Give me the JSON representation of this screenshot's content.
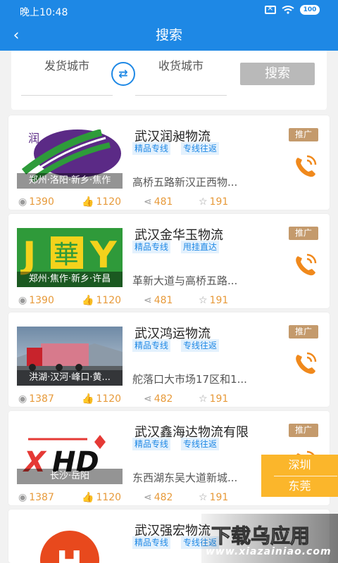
{
  "status": {
    "time": "晚上10:48",
    "battery": "100"
  },
  "header": {
    "title": "搜索"
  },
  "search": {
    "from_city": "发货城市",
    "to_city": "收货城市",
    "button": "搜索"
  },
  "cards": [
    {
      "title": "武汉润昶物流",
      "tags": [
        "精品专线",
        "专线往返"
      ],
      "caption": "郑州·洛阳·新乡·焦作",
      "address": "高桥五路新汉正西物...",
      "views": "1390",
      "likes": "1120",
      "shares": "481",
      "stars": "191",
      "promo": "推广"
    },
    {
      "title": "武汉金华玉物流",
      "tags": [
        "精品专线",
        "甩挂直达"
      ],
      "caption": "郑州·焦作·新乡·许昌",
      "address": "革新大道与高桥五路...",
      "views": "1390",
      "likes": "1120",
      "shares": "481",
      "stars": "191",
      "promo": "推广"
    },
    {
      "title": "武汉鸿运物流",
      "tags": [
        "精品专线",
        "专线往返"
      ],
      "caption": "洪湖·汉河·峰口·黄...",
      "address": "舵落口大市场17区和1...",
      "views": "1387",
      "likes": "1120",
      "shares": "482",
      "stars": "191",
      "promo": "推广"
    },
    {
      "title": "武汉鑫海达物流有限",
      "tags": [
        "精品专线",
        "专线往返"
      ],
      "caption": "长沙·岳阳",
      "address": "东西湖东吴大道新城...",
      "views": "1387",
      "likes": "1120",
      "shares": "482",
      "stars": "191",
      "promo": "推广"
    },
    {
      "title": "武汉强宏物流",
      "tags": [
        "精品专线",
        "专线往返"
      ]
    }
  ],
  "city_float": [
    "深圳",
    "东莞"
  ],
  "watermark": {
    "text": "下载乌应用",
    "url": "www.xiazainiao.com"
  }
}
